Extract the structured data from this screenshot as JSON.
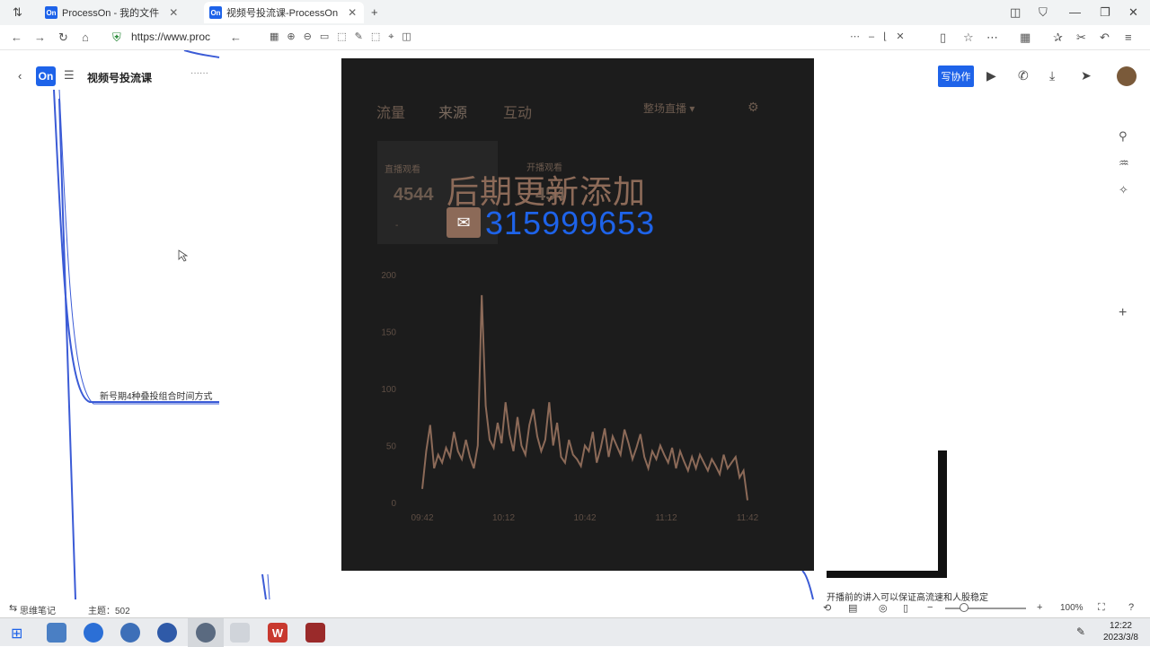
{
  "browser": {
    "tabs": [
      {
        "label": "ProcessOn - 我的文件",
        "active": false
      },
      {
        "label": "视频号投流课-ProcessOn",
        "active": true
      }
    ],
    "url": "https://www.proc",
    "new_tab_icon": "plus-icon"
  },
  "app": {
    "logo": "On",
    "doc_title": "视频号投流课",
    "collab_label": "写协作",
    "node_label": "新号期4种叠投组合时间方式",
    "bottom_note": "开播前的讲入可以保证高流速和人股稳定"
  },
  "panel": {
    "tabs": [
      "流量",
      "来源",
      "互动"
    ],
    "active_tab": "来源",
    "scene_select": "整场直播",
    "stats": [
      {
        "label": "直播观看",
        "value": "4544"
      },
      {
        "label": "开播观看",
        "value": "454"
      }
    ],
    "stat_sub": "-",
    "overlay_title": "后期更新添加",
    "overlay_number": "315999653",
    "colors": {
      "background": "#1c1c1c",
      "line": "#8c6a58",
      "overlay_number": "#1e63e9"
    }
  },
  "chart_data": {
    "type": "line",
    "title": "",
    "xlabel": "",
    "ylabel": "",
    "x_ticks": [
      "09:42",
      "10:12",
      "10:42",
      "11:12",
      "11:42"
    ],
    "y_ticks": [
      0,
      50,
      100,
      150,
      200
    ],
    "ylim": [
      0,
      200
    ],
    "grid": false,
    "series": [
      {
        "values": [
          12,
          45,
          68,
          30,
          42,
          35,
          48,
          40,
          62,
          45,
          38,
          55,
          40,
          30,
          50,
          182,
          85,
          55,
          48,
          70,
          52,
          88,
          60,
          45,
          75,
          50,
          42,
          68,
          82,
          58,
          45,
          55,
          88,
          50,
          70,
          40,
          35,
          55,
          42,
          38,
          32,
          50,
          45,
          62,
          35,
          48,
          65,
          40,
          58,
          50,
          42,
          64,
          52,
          38,
          48,
          60,
          40,
          30,
          45,
          38,
          50,
          42,
          35,
          48,
          30,
          45,
          36,
          28,
          40,
          30,
          42,
          35,
          28,
          38,
          32,
          25,
          42,
          30,
          35,
          40,
          22,
          28,
          2
        ]
      }
    ]
  },
  "statusbar": {
    "left_label": "思维笔记",
    "topic_label": "主题：502",
    "zoom": "100%"
  },
  "taskbar": {
    "time": "12:22",
    "date": "2023/3/8"
  }
}
